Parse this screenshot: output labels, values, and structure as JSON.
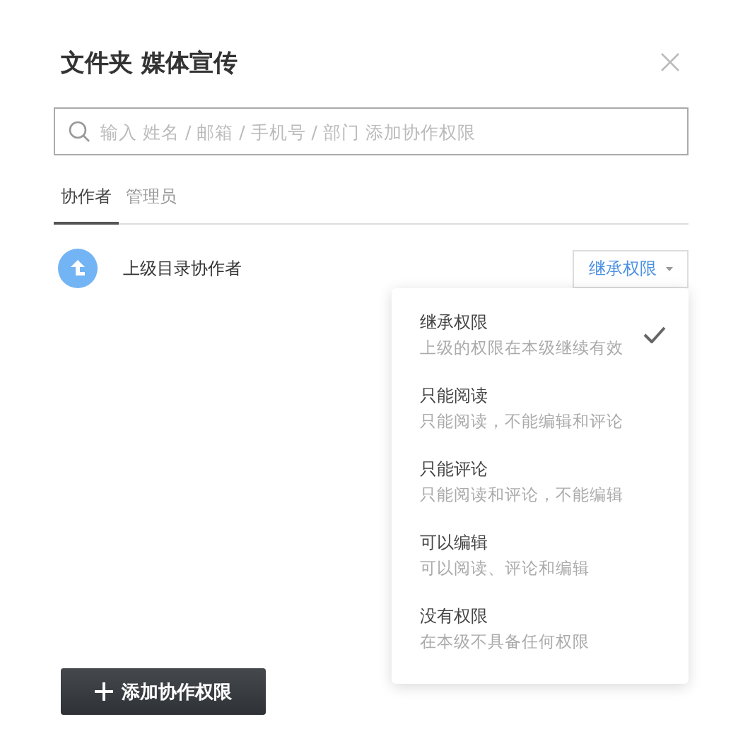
{
  "dialog": {
    "title": "文件夹 媒体宣传"
  },
  "search": {
    "placeholder": "输入 姓名 / 邮箱 / 手机号 / 部门 添加协作权限"
  },
  "tabs": [
    {
      "label": "协作者",
      "selected": true
    },
    {
      "label": "管理员",
      "selected": false
    }
  ],
  "collaborators": [
    {
      "name": "上级目录协作者",
      "permission": "继承权限"
    }
  ],
  "permission_menu": [
    {
      "title": "继承权限",
      "description": "上级的权限在本级继续有效",
      "selected": true
    },
    {
      "title": "只能阅读",
      "description": "只能阅读，不能编辑和评论",
      "selected": false
    },
    {
      "title": "只能评论",
      "description": "只能阅读和评论，不能编辑",
      "selected": false
    },
    {
      "title": "可以编辑",
      "description": "可以阅读、评论和编辑",
      "selected": false
    },
    {
      "title": "没有权限",
      "description": "在本级不具备任何权限",
      "selected": false
    }
  ],
  "add_button": {
    "label": "添加协作权限"
  }
}
